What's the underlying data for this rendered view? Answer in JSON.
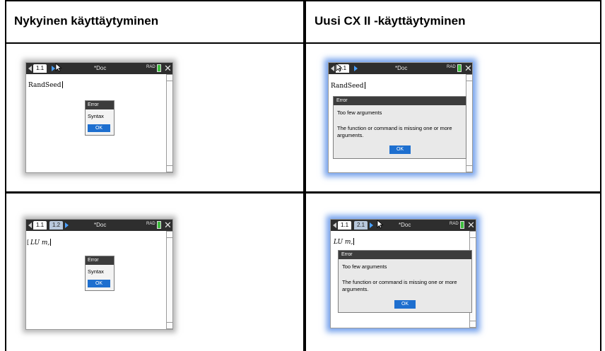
{
  "columns": {
    "current": "Nykyinen käyttäytyminen",
    "new": "Uusi CX II -käyttäytyminen"
  },
  "rows": [
    {
      "current": {
        "tabs": [
          "1.1"
        ],
        "title": "*Doc",
        "angle_mode": "RAD",
        "entry": "RandSeed",
        "error": {
          "title": "Error",
          "message": "Syntax",
          "ok": "OK"
        }
      },
      "new": {
        "tabs": [
          "1.1"
        ],
        "title": "*Doc",
        "angle_mode": "RAD",
        "entry": "RandSeed",
        "error": {
          "title": "Error",
          "message": "Too few arguments",
          "detail": "The function or command is missing one or more arguments.",
          "ok": "OK"
        }
      }
    },
    {
      "current": {
        "tabs": [
          "1.1",
          "1.2"
        ],
        "title": "*Doc",
        "angle_mode": "RAD",
        "entry": "LU m,",
        "error": {
          "title": "Error",
          "message": "Syntax",
          "ok": "OK"
        }
      },
      "new": {
        "tabs": [
          "1.1",
          "2.1"
        ],
        "title": "*Doc",
        "angle_mode": "RAD",
        "entry": "LU m,",
        "error": {
          "title": "Error",
          "message": "Too few arguments",
          "detail": "The function or command is missing one or more arguments.",
          "ok": "OK"
        }
      }
    }
  ]
}
